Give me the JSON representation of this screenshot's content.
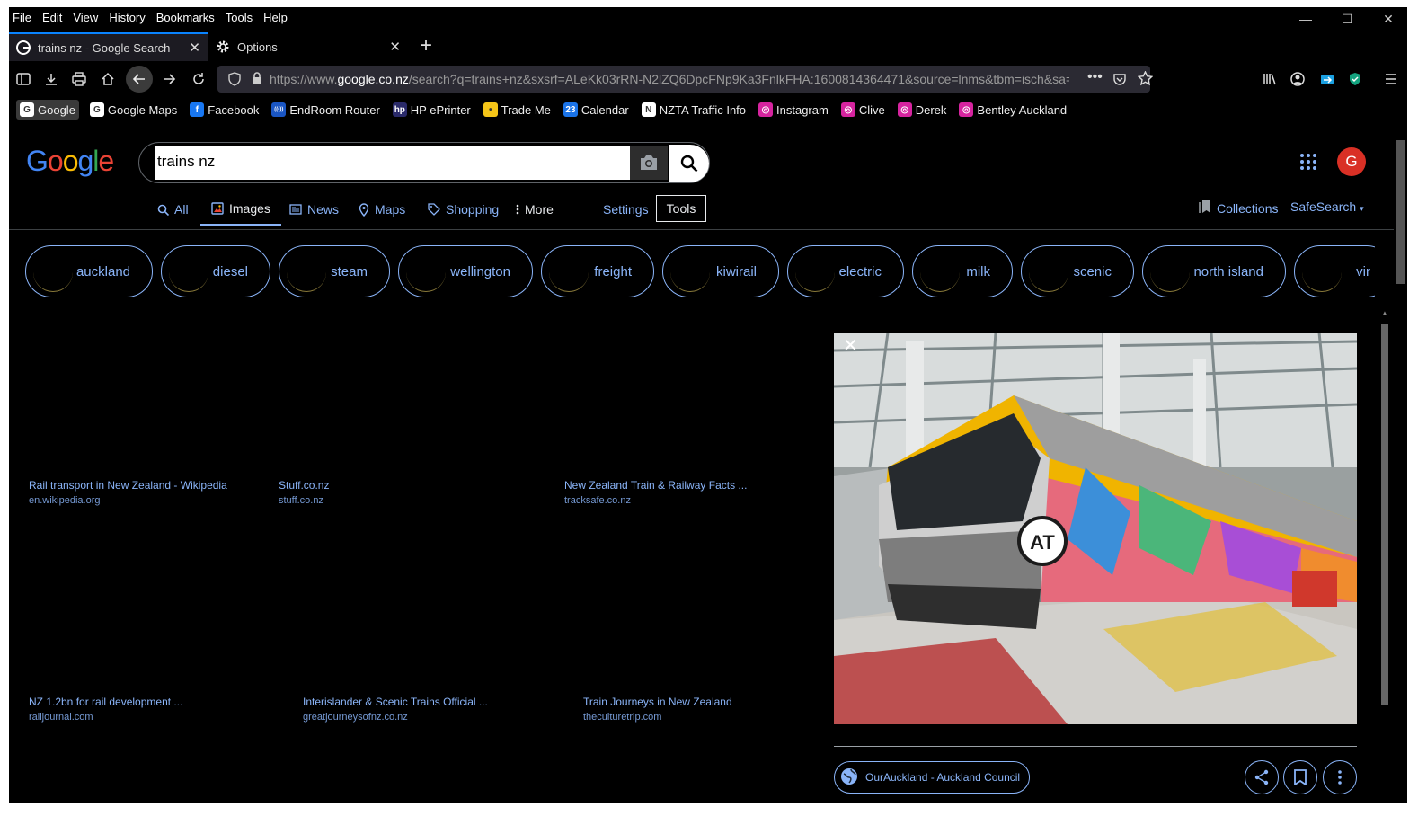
{
  "menu": [
    "File",
    "Edit",
    "View",
    "History",
    "Bookmarks",
    "Tools",
    "Help"
  ],
  "window_controls": {
    "minimize": "—",
    "maximize": "☐",
    "close": "✕"
  },
  "tabs": [
    {
      "title": "trains nz - Google Search",
      "active": true
    },
    {
      "title": "Options",
      "active": false
    }
  ],
  "newtab": "+",
  "url": {
    "prefix": "https://www.",
    "domain": "google.co.nz",
    "path": "/search?q=trains+nz&sxsrf=ALeKk03rRN-N2lZQ6DpcFNp9Ka3FnlkFHA:1600814364471&source=lnms&tbm=isch&sa=X"
  },
  "bookmarks": [
    {
      "label": "Google",
      "icon": "G",
      "color": "#ffffff"
    },
    {
      "label": "Google Maps",
      "icon": "G",
      "color": "#ffffff"
    },
    {
      "label": "Facebook",
      "icon": "f",
      "color": "#1877f2"
    },
    {
      "label": "EndRoom Router",
      "icon": "((•))",
      "color": "#1a56c4"
    },
    {
      "label": "HP ePrinter",
      "icon": "hp",
      "color": "#2a2a6a"
    },
    {
      "label": "Trade Me",
      "icon": "•",
      "color": "#f5c518"
    },
    {
      "label": "Calendar",
      "icon": "23",
      "color": "#1a73e8"
    },
    {
      "label": "NZTA Traffic Info",
      "icon": "N",
      "color": "#ffffff"
    },
    {
      "label": "Instagram",
      "icon": "◎",
      "color": "#d6249f"
    },
    {
      "label": "Clive",
      "icon": "◎",
      "color": "#d6249f"
    },
    {
      "label": "Derek",
      "icon": "◎",
      "color": "#d6249f"
    },
    {
      "label": "Bentley Auckland",
      "icon": "◎",
      "color": "#d6249f"
    }
  ],
  "search": {
    "query": "trains nz"
  },
  "avatar_letter": "G",
  "google_tabs": [
    {
      "label": "All",
      "icon": "search-icon"
    },
    {
      "label": "Images",
      "icon": "image-icon",
      "active": true
    },
    {
      "label": "News",
      "icon": "news-icon"
    },
    {
      "label": "Maps",
      "icon": "map-pin-icon"
    },
    {
      "label": "Shopping",
      "icon": "tag-icon"
    },
    {
      "label": "More",
      "icon": "kebab-icon"
    }
  ],
  "settings_label": "Settings",
  "tools_label": "Tools",
  "collections_label": "Collections",
  "safesearch_label": "SafeSearch",
  "chips": [
    "auckland",
    "diesel",
    "steam",
    "wellington",
    "freight",
    "kiwirail",
    "electric",
    "milk",
    "scenic",
    "north island",
    "vir"
  ],
  "results": [
    {
      "title": "Rail transport in New Zealand - Wikipedia",
      "site": "en.wikipedia.org"
    },
    {
      "title": "Stuff.co.nz",
      "site": "stuff.co.nz"
    },
    {
      "title": "New Zealand Train & Railway Facts ...",
      "site": "tracksafe.co.nz"
    },
    {
      "title": "NZ 1.2bn for rail development ...",
      "site": "railjournal.com"
    },
    {
      "title": "Interislander & Scenic Trains Official ...",
      "site": "greatjourneysofnz.co.nz"
    },
    {
      "title": "Train Journeys in New Zealand",
      "site": "theculturetrip.com"
    }
  ],
  "preview": {
    "logo_text": "AT",
    "source": "OurAuckland - Auckland Council"
  }
}
